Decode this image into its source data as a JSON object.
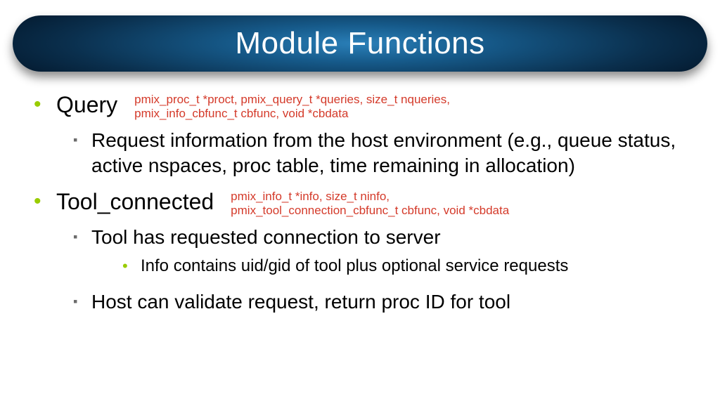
{
  "title": "Module Functions",
  "items": [
    {
      "heading": "Query",
      "signature_line1": "pmix_proc_t *proct, pmix_query_t *queries, size_t nqueries,",
      "signature_line2": "pmix_info_cbfunc_t cbfunc, void *cbdata",
      "subs": [
        {
          "text": "Request information from the host environment (e.g., queue status, active nspaces, proc table, time remaining in allocation)",
          "subs": []
        }
      ]
    },
    {
      "heading": "Tool_connected",
      "signature_line1": "pmix_info_t *info, size_t ninfo,",
      "signature_line2": "pmix_tool_connection_cbfunc_t cbfunc, void *cbdata",
      "subs": [
        {
          "text": "Tool has requested connection to server",
          "subs": [
            {
              "text": "Info contains uid/gid of tool plus optional service requests"
            }
          ]
        },
        {
          "text": "Host can validate request, return proc ID for tool",
          "subs": []
        }
      ]
    }
  ]
}
